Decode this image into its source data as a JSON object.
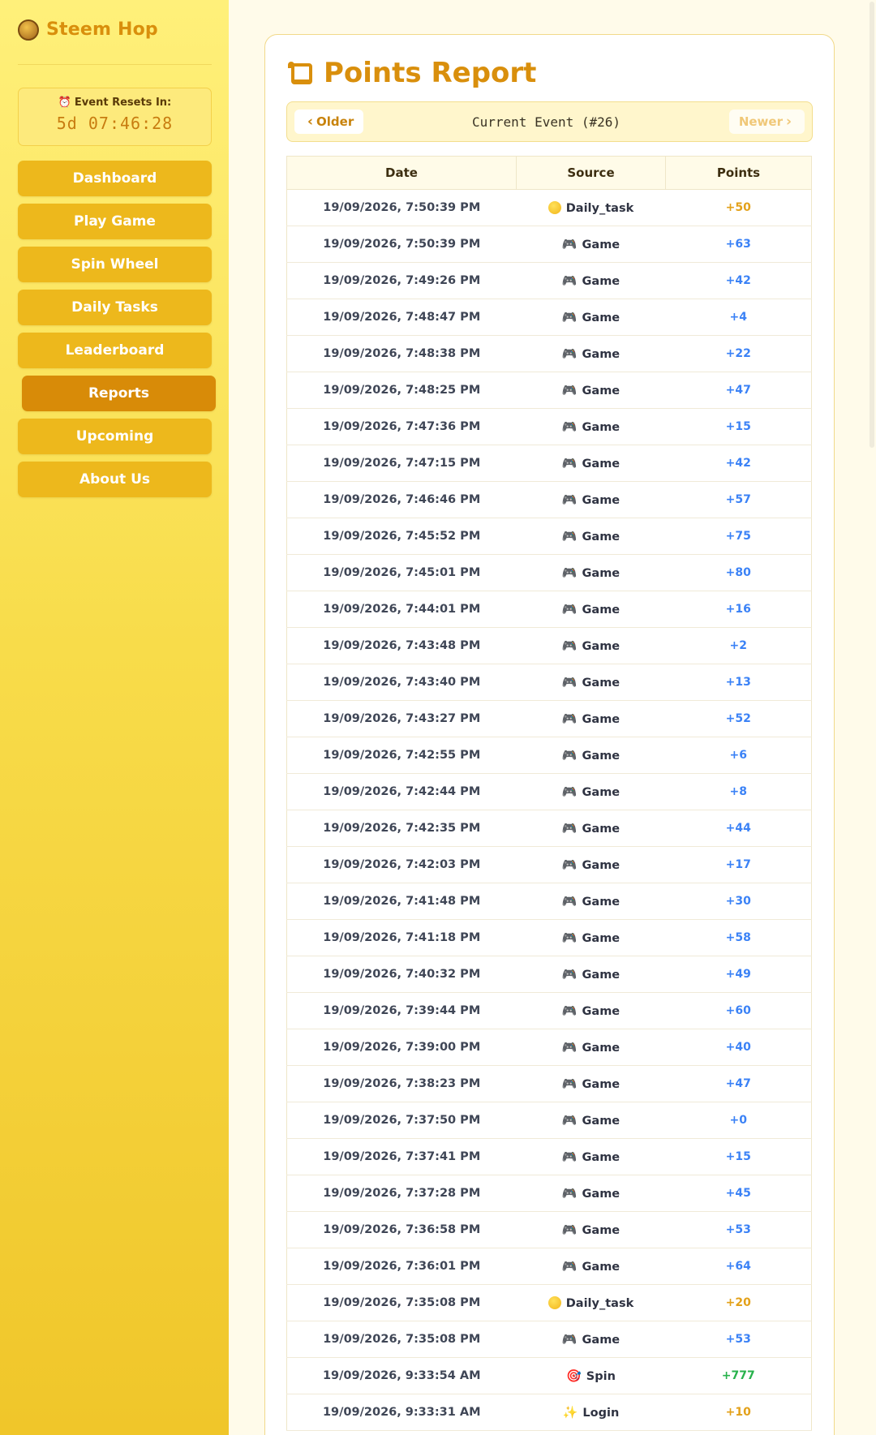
{
  "brand": {
    "title": "Steem Hop",
    "logo_text": "STEEM HOP"
  },
  "timer": {
    "label": "Event Resets In:",
    "value": "5d 07:46:28"
  },
  "nav": [
    {
      "label": "Dashboard",
      "active": false
    },
    {
      "label": "Play Game",
      "active": false
    },
    {
      "label": "Spin Wheel",
      "active": false
    },
    {
      "label": "Daily Tasks",
      "active": false
    },
    {
      "label": "Leaderboard",
      "active": false
    },
    {
      "label": "Reports",
      "active": true
    },
    {
      "label": "Upcoming",
      "active": false
    },
    {
      "label": "About Us",
      "active": false
    }
  ],
  "report": {
    "title": "Points Report",
    "older_label": "Older",
    "newer_label": "Newer",
    "current_event": "Current Event (#26)",
    "columns": [
      "Date",
      "Source",
      "Points"
    ],
    "rows": [
      {
        "date": "19/09/2026, 7:50:39 PM",
        "source": "Daily_task",
        "icon": "coin-icon",
        "points": "+50",
        "kind": "daily"
      },
      {
        "date": "19/09/2026, 7:50:39 PM",
        "source": "Game",
        "icon": "gamepad-icon",
        "points": "+63",
        "kind": "game"
      },
      {
        "date": "19/09/2026, 7:49:26 PM",
        "source": "Game",
        "icon": "gamepad-icon",
        "points": "+42",
        "kind": "game"
      },
      {
        "date": "19/09/2026, 7:48:47 PM",
        "source": "Game",
        "icon": "gamepad-icon",
        "points": "+4",
        "kind": "game"
      },
      {
        "date": "19/09/2026, 7:48:38 PM",
        "source": "Game",
        "icon": "gamepad-icon",
        "points": "+22",
        "kind": "game"
      },
      {
        "date": "19/09/2026, 7:48:25 PM",
        "source": "Game",
        "icon": "gamepad-icon",
        "points": "+47",
        "kind": "game"
      },
      {
        "date": "19/09/2026, 7:47:36 PM",
        "source": "Game",
        "icon": "gamepad-icon",
        "points": "+15",
        "kind": "game"
      },
      {
        "date": "19/09/2026, 7:47:15 PM",
        "source": "Game",
        "icon": "gamepad-icon",
        "points": "+42",
        "kind": "game"
      },
      {
        "date": "19/09/2026, 7:46:46 PM",
        "source": "Game",
        "icon": "gamepad-icon",
        "points": "+57",
        "kind": "game"
      },
      {
        "date": "19/09/2026, 7:45:52 PM",
        "source": "Game",
        "icon": "gamepad-icon",
        "points": "+75",
        "kind": "game"
      },
      {
        "date": "19/09/2026, 7:45:01 PM",
        "source": "Game",
        "icon": "gamepad-icon",
        "points": "+80",
        "kind": "game"
      },
      {
        "date": "19/09/2026, 7:44:01 PM",
        "source": "Game",
        "icon": "gamepad-icon",
        "points": "+16",
        "kind": "game"
      },
      {
        "date": "19/09/2026, 7:43:48 PM",
        "source": "Game",
        "icon": "gamepad-icon",
        "points": "+2",
        "kind": "game"
      },
      {
        "date": "19/09/2026, 7:43:40 PM",
        "source": "Game",
        "icon": "gamepad-icon",
        "points": "+13",
        "kind": "game"
      },
      {
        "date": "19/09/2026, 7:43:27 PM",
        "source": "Game",
        "icon": "gamepad-icon",
        "points": "+52",
        "kind": "game"
      },
      {
        "date": "19/09/2026, 7:42:55 PM",
        "source": "Game",
        "icon": "gamepad-icon",
        "points": "+6",
        "kind": "game"
      },
      {
        "date": "19/09/2026, 7:42:44 PM",
        "source": "Game",
        "icon": "gamepad-icon",
        "points": "+8",
        "kind": "game"
      },
      {
        "date": "19/09/2026, 7:42:35 PM",
        "source": "Game",
        "icon": "gamepad-icon",
        "points": "+44",
        "kind": "game"
      },
      {
        "date": "19/09/2026, 7:42:03 PM",
        "source": "Game",
        "icon": "gamepad-icon",
        "points": "+17",
        "kind": "game"
      },
      {
        "date": "19/09/2026, 7:41:48 PM",
        "source": "Game",
        "icon": "gamepad-icon",
        "points": "+30",
        "kind": "game"
      },
      {
        "date": "19/09/2026, 7:41:18 PM",
        "source": "Game",
        "icon": "gamepad-icon",
        "points": "+58",
        "kind": "game"
      },
      {
        "date": "19/09/2026, 7:40:32 PM",
        "source": "Game",
        "icon": "gamepad-icon",
        "points": "+49",
        "kind": "game"
      },
      {
        "date": "19/09/2026, 7:39:44 PM",
        "source": "Game",
        "icon": "gamepad-icon",
        "points": "+60",
        "kind": "game"
      },
      {
        "date": "19/09/2026, 7:39:00 PM",
        "source": "Game",
        "icon": "gamepad-icon",
        "points": "+40",
        "kind": "game"
      },
      {
        "date": "19/09/2026, 7:38:23 PM",
        "source": "Game",
        "icon": "gamepad-icon",
        "points": "+47",
        "kind": "game"
      },
      {
        "date": "19/09/2026, 7:37:50 PM",
        "source": "Game",
        "icon": "gamepad-icon",
        "points": "+0",
        "kind": "game"
      },
      {
        "date": "19/09/2026, 7:37:41 PM",
        "source": "Game",
        "icon": "gamepad-icon",
        "points": "+15",
        "kind": "game"
      },
      {
        "date": "19/09/2026, 7:37:28 PM",
        "source": "Game",
        "icon": "gamepad-icon",
        "points": "+45",
        "kind": "game"
      },
      {
        "date": "19/09/2026, 7:36:58 PM",
        "source": "Game",
        "icon": "gamepad-icon",
        "points": "+53",
        "kind": "game"
      },
      {
        "date": "19/09/2026, 7:36:01 PM",
        "source": "Game",
        "icon": "gamepad-icon",
        "points": "+64",
        "kind": "game"
      },
      {
        "date": "19/09/2026, 7:35:08 PM",
        "source": "Daily_task",
        "icon": "coin-icon",
        "points": "+20",
        "kind": "daily"
      },
      {
        "date": "19/09/2026, 7:35:08 PM",
        "source": "Game",
        "icon": "gamepad-icon",
        "points": "+53",
        "kind": "game"
      },
      {
        "date": "19/09/2026, 9:33:54 AM",
        "source": "Spin",
        "icon": "target-icon",
        "points": "+777",
        "kind": "spin"
      },
      {
        "date": "19/09/2026, 9:33:31 AM",
        "source": "Login",
        "icon": "sparkles-icon",
        "points": "+10",
        "kind": "login"
      }
    ]
  },
  "colors": {
    "accent": "#d98f0c",
    "nav_bg": "#edb81c",
    "nav_active": "#d88b08",
    "points_game": "#3b82f6",
    "points_daily": "#e3a11a",
    "points_spin": "#28b24c"
  }
}
